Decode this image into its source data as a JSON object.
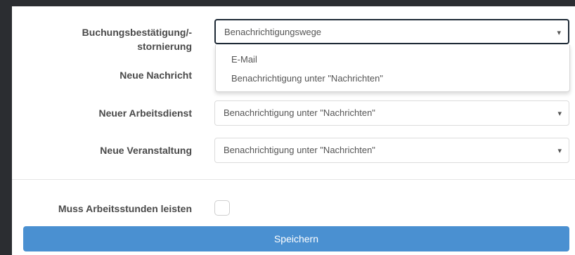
{
  "form": {
    "rows": [
      {
        "label_line1": "Buchungsbestätigung/-",
        "label_line2": "stornierung",
        "value": "Benachrichtigungswege"
      },
      {
        "label": "Neue Nachricht"
      },
      {
        "label": "Neuer Arbeitsdienst",
        "value": "Benachrichtigung unter \"Nachrichten\""
      },
      {
        "label": "Neue Veranstaltung",
        "value": "Benachrichtigung unter \"Nachrichten\""
      }
    ],
    "dropdown_options": [
      "E-Mail",
      "Benachrichtigung unter \"Nachrichten\""
    ],
    "checkbox_label": "Muss Arbeitsstunden leisten",
    "checkbox_checked": false,
    "save_label": "Speichern",
    "arrow_glyph": "▾"
  },
  "colors": {
    "page_bg": "#2b2d31",
    "panel_bg": "#ffffff",
    "active_border": "#1e2a36",
    "save_button": "#4a90d1"
  }
}
